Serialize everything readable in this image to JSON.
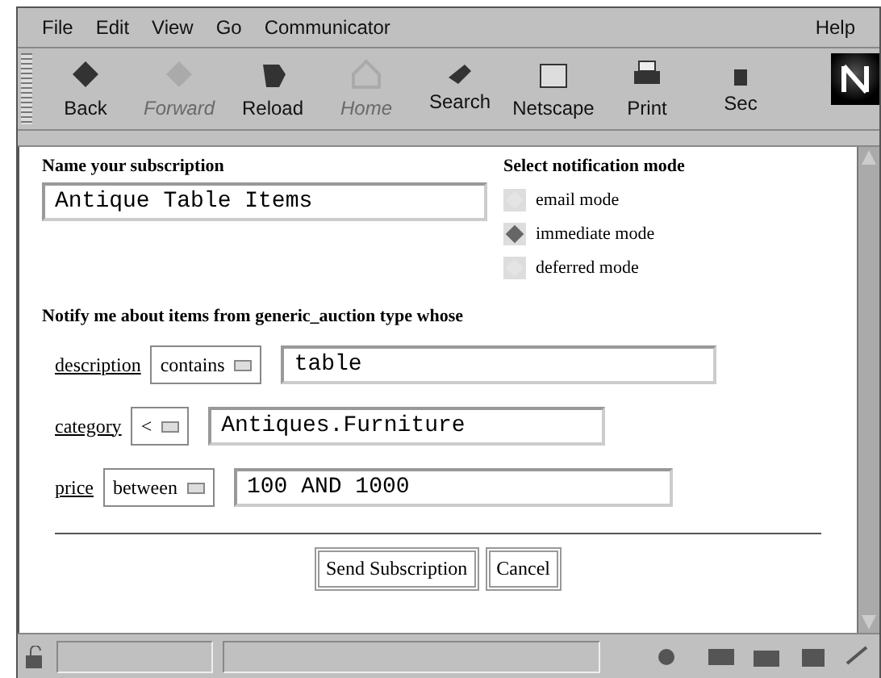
{
  "menu": [
    {
      "label": "File"
    },
    {
      "label": "Edit"
    },
    {
      "label": "View"
    },
    {
      "label": "Go"
    },
    {
      "label": "Communicator"
    }
  ],
  "help_menu": "Help",
  "toolbar": [
    {
      "label": "Back",
      "kind": "back",
      "disabled": false
    },
    {
      "label": "Forward",
      "kind": "forward",
      "disabled": true
    },
    {
      "label": "Reload",
      "kind": "reload",
      "disabled": false
    },
    {
      "label": "Home",
      "kind": "home",
      "disabled": true
    },
    {
      "label": "Search",
      "kind": "search",
      "disabled": false
    },
    {
      "label": "Netscape",
      "kind": "netscape",
      "disabled": false
    },
    {
      "label": "Print",
      "kind": "print",
      "disabled": false
    },
    {
      "label": "Sec",
      "kind": "security",
      "disabled": false
    }
  ],
  "form": {
    "name_label": "Name your subscription",
    "name_value": "Antique Table Items",
    "mode_label": "Select notification mode",
    "modes": [
      {
        "label": "email mode",
        "selected": false
      },
      {
        "label": "immediate mode",
        "selected": true
      },
      {
        "label": "deferred mode",
        "selected": false
      }
    ],
    "notify_heading": "Notify me about items from generic_auction type whose",
    "criteria": [
      {
        "field": "description",
        "operator": "contains",
        "value": "table"
      },
      {
        "field": "category",
        "operator": "<",
        "value": "Antiques.Furniture"
      },
      {
        "field": "price",
        "operator": "between",
        "value": "100 AND 1000"
      }
    ],
    "buttons": [
      "Send Subscription",
      "Cancel"
    ]
  }
}
